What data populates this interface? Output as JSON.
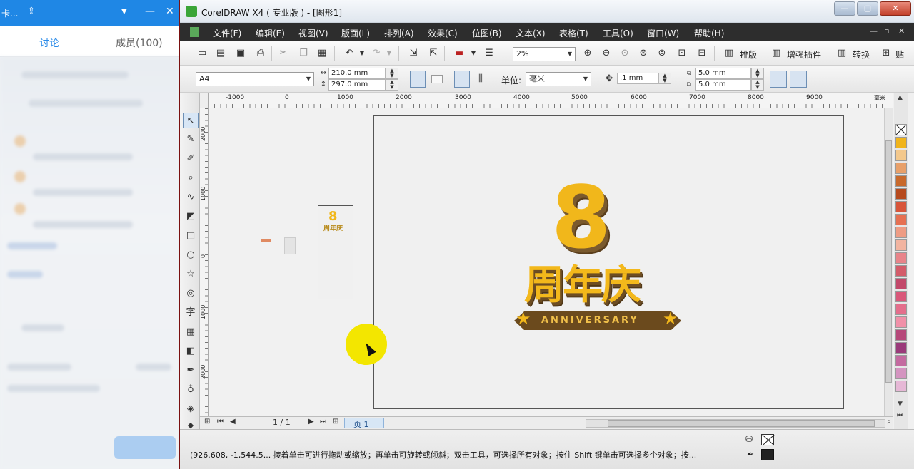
{
  "chat": {
    "title": "卡...",
    "tabs": [
      {
        "label": "讨论",
        "active": true
      },
      {
        "label": "成员(100)",
        "active": false
      }
    ]
  },
  "window": {
    "title": "CorelDRAW X4 ( 专业版 ) - [图形1]",
    "menus": [
      "文件(F)",
      "编辑(E)",
      "视图(V)",
      "版面(L)",
      "排列(A)",
      "效果(C)",
      "位图(B)",
      "文本(X)",
      "表格(T)",
      "工具(O)",
      "窗口(W)",
      "帮助(H)"
    ]
  },
  "toolbar": {
    "zoom_value": "2%",
    "buttons": [
      "排版",
      "增强插件",
      "转换",
      "贴"
    ]
  },
  "property_bar": {
    "page_size": "A4",
    "width": "210.0 mm",
    "height": "297.0 mm",
    "unit_label": "单位:",
    "unit_value": "毫米",
    "nudge": ".1 mm",
    "dup_x": "5.0 mm",
    "dup_y": "5.0 mm"
  },
  "ruler": {
    "h_labels": [
      "-1000",
      "0",
      "1000",
      "2000",
      "3000",
      "4000",
      "5000",
      "6000",
      "7000",
      "8000",
      "9000"
    ],
    "unit": "毫米",
    "v_labels": [
      "2000",
      "1000",
      "0",
      "1000",
      "2000"
    ]
  },
  "artwork": {
    "number": "8",
    "chinese": "周年庆",
    "ribbon_text": "ANNIVERSARY"
  },
  "page_nav": {
    "counter": "1 / 1",
    "tab_label": "页 1"
  },
  "status": {
    "message": "(926.608, -1,544.5...   接着单击可进行拖动或缩放；再单击可旋转或倾斜；双击工具，可选择所有对象；按住 Shift 键单击可选择多个对象；按..."
  },
  "palette_colors": [
    "#f0b41c",
    "#f3c88c",
    "#e8a06a",
    "#c8692c",
    "#b64a1e",
    "#d8553a",
    "#e67052",
    "#ee9c84",
    "#f2b4a0",
    "#e8848a",
    "#d35c6a",
    "#c2486a",
    "#d9587a",
    "#e46e8c",
    "#f090a8",
    "#b6487a",
    "#9a3a7a",
    "#c46aa0",
    "#d494c0",
    "#e6b8d6"
  ],
  "colors": {
    "accent_blue": "#1f87e5",
    "logo_gold": "#f1b71b",
    "logo_brown": "#6b4a1d",
    "cursor_highlight": "#f3e600"
  }
}
